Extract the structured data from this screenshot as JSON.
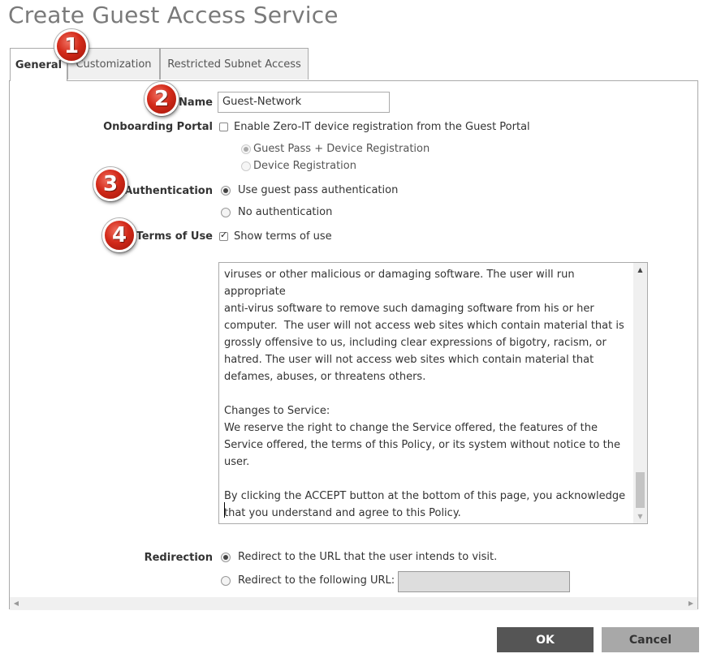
{
  "title": "Create Guest Access Service",
  "tabs": [
    {
      "label": "General",
      "active": true
    },
    {
      "label": "Customization",
      "active": false
    },
    {
      "label": "Restricted Subnet Access",
      "active": false
    }
  ],
  "form": {
    "name": {
      "label": "Name",
      "value": "Guest-Network"
    },
    "onboarding": {
      "label": "Onboarding Portal",
      "checkbox_label": "Enable Zero-IT device registration from the Guest Portal",
      "checked": false,
      "options": [
        {
          "label": "Guest Pass + Device Registration",
          "selected": true,
          "disabled": true
        },
        {
          "label": "Device Registration",
          "selected": false,
          "disabled": true
        }
      ]
    },
    "authentication": {
      "label": "Authentication",
      "options": [
        {
          "label": "Use guest pass authentication",
          "selected": true
        },
        {
          "label": "No authentication",
          "selected": false
        }
      ]
    },
    "terms": {
      "label": "Terms of Use",
      "checkbox_label": "Show terms of use",
      "checked": true,
      "text": "viruses or other malicious or damaging software. The user will run appropriate\nanti-virus software to remove such damaging software from his or her\ncomputer.  The user will not access web sites which contain material that is\ngrossly offensive to us, including clear expressions of bigotry, racism, or\nhatred. The user will not access web sites which contain material that\ndefames, abuses, or threatens others.\n\nChanges to Service:\nWe reserve the right to change the Service offered, the features of the\nService offered, the terms of this Policy, or its system without notice to the\nuser.\n\nBy clicking the ACCEPT button at the bottom of this page, you acknowledge\nthat you understand and agree to this Policy."
    },
    "redirection": {
      "label": "Redirection",
      "options": [
        {
          "label": "Redirect to the URL that the user intends to visit.",
          "selected": true
        },
        {
          "label": "Redirect to the following URL:",
          "selected": false
        }
      ],
      "url_value": ""
    }
  },
  "buttons": {
    "ok": "OK",
    "cancel": "Cancel"
  },
  "callouts": [
    "1",
    "2",
    "3",
    "4"
  ],
  "colors": {
    "callout": "#d32a1a",
    "ok_bg": "#555555",
    "cancel_bg": "#a8a8a8",
    "title": "#7a7a7a"
  }
}
